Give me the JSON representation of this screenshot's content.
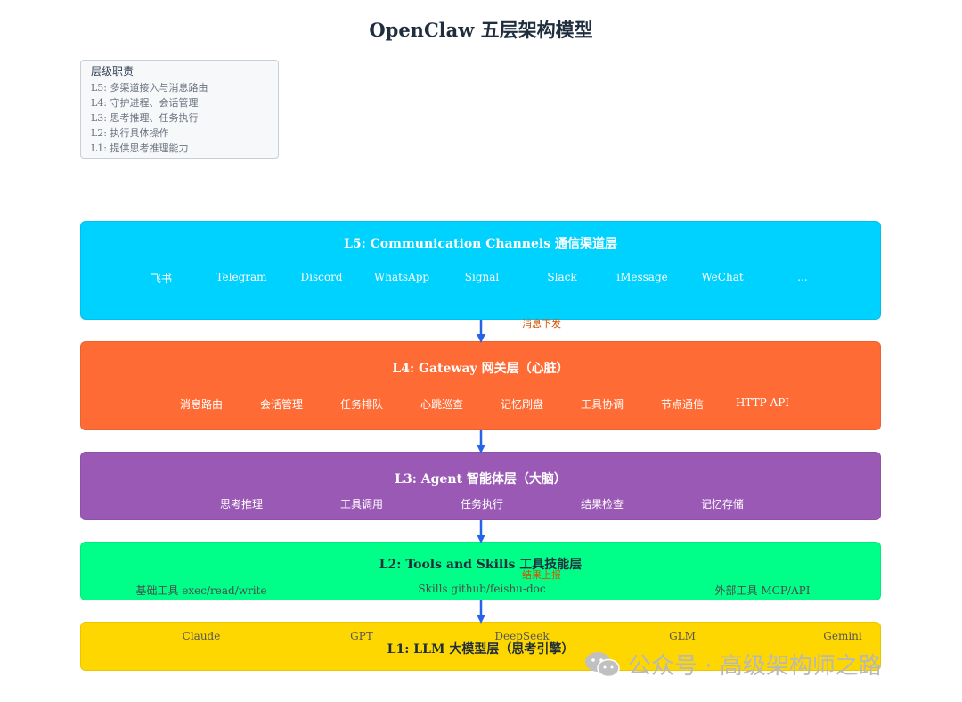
{
  "title": "OpenClaw 五层架构模型",
  "legend": {
    "title": "层级职责",
    "items": [
      "L5: 多渠道接入与消息路由",
      "L4: 守护进程、会话管理",
      "L3: 思考推理、任务执行",
      "L2: 执行具体操作",
      "L1: 提供思考推理能力"
    ]
  },
  "layers": {
    "l5": {
      "title": "L5: Communication Channels 通信渠道层",
      "color": "#00d2ff",
      "items": [
        "飞书",
        "Telegram",
        "Discord",
        "WhatsApp",
        "Signal",
        "Slack",
        "iMessage",
        "WeChat",
        "..."
      ]
    },
    "l4": {
      "title": "L4: Gateway 网关层（心脏）",
      "color": "#ff6b35",
      "items": [
        "消息路由",
        "会话管理",
        "任务排队",
        "心跳巡查",
        "记忆刷盘",
        "工具协调",
        "节点通信",
        "HTTP API"
      ]
    },
    "l3": {
      "title": "L3: Agent 智能体层（大脑）",
      "color": "#9b59b6",
      "items": [
        "思考推理",
        "工具调用",
        "任务执行",
        "结果检查",
        "记忆存储"
      ]
    },
    "l2": {
      "title": "L2: Tools and Skills 工具技能层",
      "color": "#00ff88",
      "items": [
        "基础工具 exec/read/write",
        "Skills github/feishu-doc",
        "外部工具 MCP/API"
      ]
    },
    "l1": {
      "title": "L1: LLM 大模型层（思考引擎）",
      "color": "#ffd700",
      "items": [
        "Claude",
        "GPT",
        "DeepSeek",
        "GLM",
        "Gemini"
      ]
    }
  },
  "edge_labels": {
    "dispatch": "消息下发",
    "report": "结果上报"
  },
  "arrow_color": "#2563eb",
  "watermark": "公众号 · 高级架构师之路"
}
